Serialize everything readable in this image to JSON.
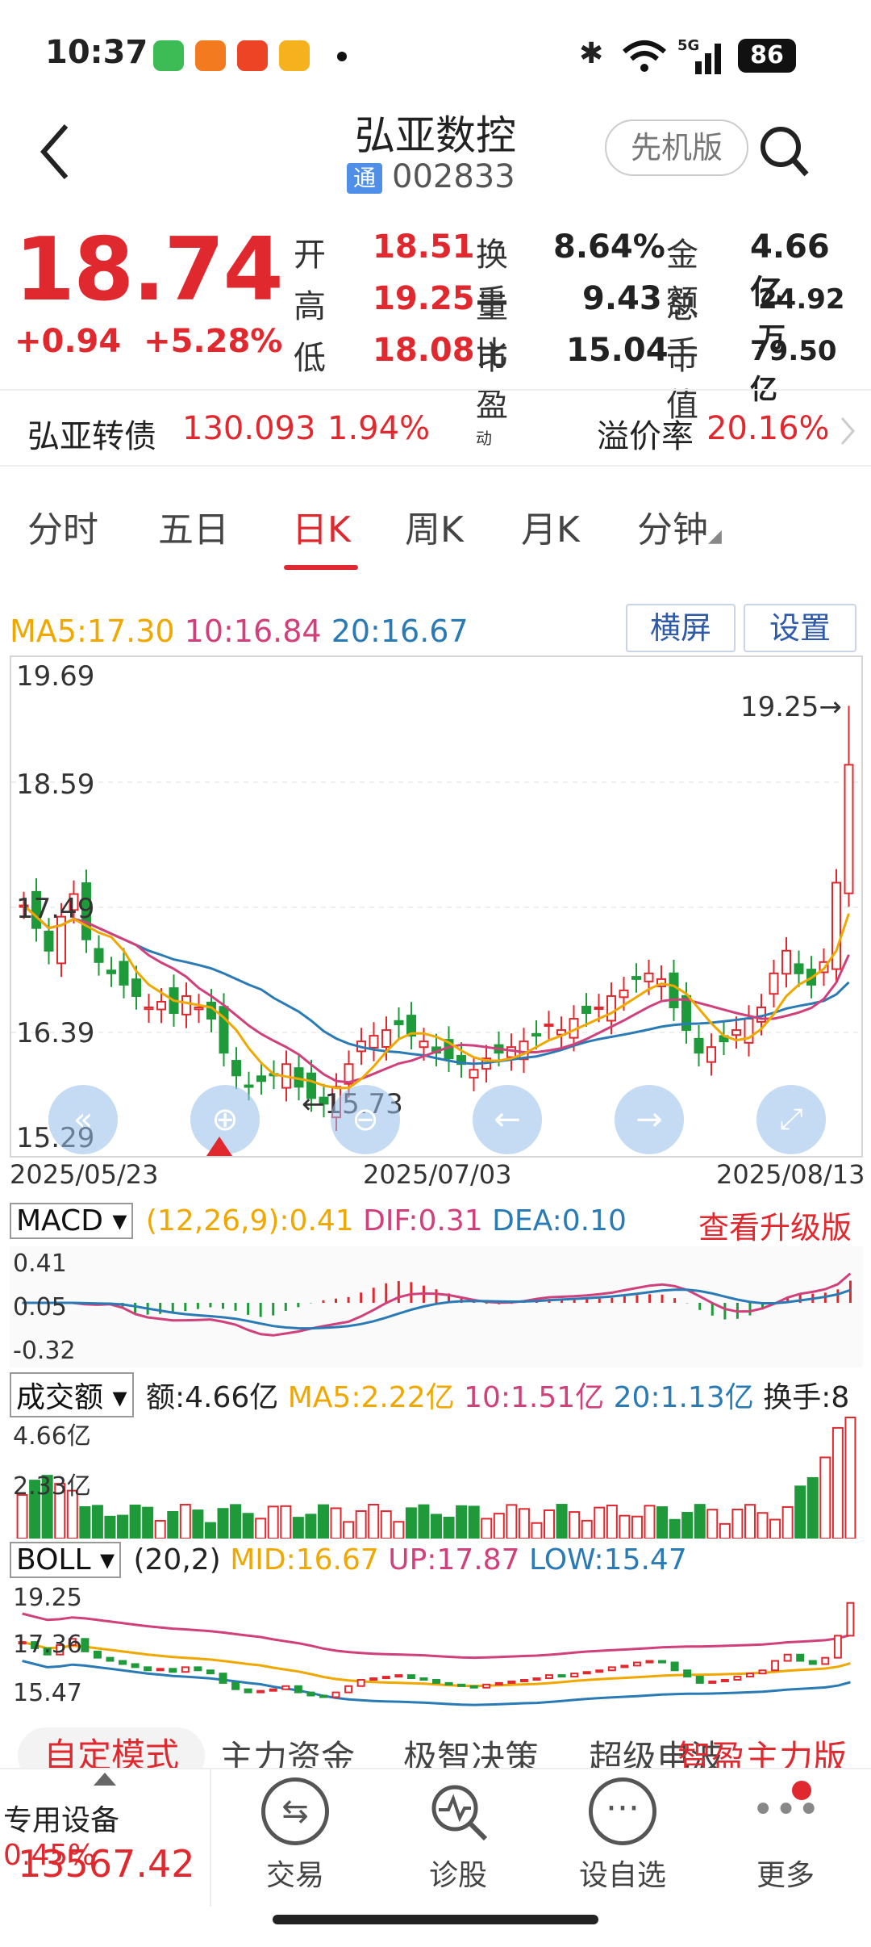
{
  "status": {
    "time": "10:37",
    "battery": "86",
    "network": "5G"
  },
  "header": {
    "name": "弘亚数控",
    "tong": "通",
    "code": "002833",
    "pill": "先机版"
  },
  "quote": {
    "price": "18.74",
    "change": "+0.94",
    "change_pct": "+5.28%",
    "rows": [
      [
        {
          "l": "开",
          "v": "18.51"
        },
        {
          "l": "换手",
          "v": "8.64%"
        },
        {
          "l": "金额",
          "v": "4.66亿"
        }
      ],
      [
        {
          "l": "高",
          "v": "19.25"
        },
        {
          "l": "量比",
          "v": "9.43"
        },
        {
          "l": "总手",
          "v": "24.92万"
        }
      ],
      [
        {
          "l": "低",
          "v": "18.08"
        },
        {
          "l": "市盈",
          "sup": "动",
          "v": "15.04"
        },
        {
          "l": "市值",
          "v": "79.50亿"
        }
      ]
    ]
  },
  "bond": {
    "name": "弘亚转债",
    "price": "130.093",
    "pct": "1.94%",
    "premium_label": "溢价率",
    "premium": "20.16%"
  },
  "tabs": [
    "分时",
    "五日",
    "日K",
    "周K",
    "月K",
    "分钟"
  ],
  "active_tab": "日K",
  "ma": {
    "ma5": "MA5:17.30",
    "ma10": "10:16.84",
    "ma20": "20:16.67"
  },
  "buttons": {
    "landscape": "横屏",
    "settings": "设置"
  },
  "kline": {
    "y_labels": [
      "19.69",
      "18.59",
      "17.49",
      "16.39",
      "15.29"
    ],
    "dates": [
      "2025/05/23",
      "2025/07/03",
      "2025/08/13"
    ],
    "high_mark": "19.25",
    "low_mark": "15.73"
  },
  "macd": {
    "name": "MACD",
    "params": "(12,26,9):0.41",
    "dif": "DIF:0.31",
    "dea": "DEA:0.10",
    "upgrade": "查看升级版",
    "y": [
      "0.41",
      "0.05",
      "-0.32"
    ]
  },
  "volume": {
    "name": "成交额",
    "amount": "额:4.66亿",
    "ma5": "MA5:2.22亿",
    "ma10": "10:1.51亿",
    "ma20": "20:1.13亿",
    "turnover": "换手:8",
    "y": [
      "4.66亿",
      "2.33亿"
    ]
  },
  "boll": {
    "name": "BOLL",
    "params": "(20,2)",
    "mid": "MID:16.67",
    "up": "UP:17.87",
    "low": "LOW:15.47",
    "y": [
      "19.25",
      "17.36",
      "15.47"
    ]
  },
  "bottom_tabs": [
    "自定模式",
    "主力资金",
    "极智决策",
    "超级电波",
    "智盈主力版"
  ],
  "footer": {
    "index_name": "专用设备",
    "index_pct": "0.45%",
    "index_value": "13567.42",
    "items": [
      "交易",
      "诊股",
      "设自选",
      "更多"
    ]
  },
  "colors": {
    "up": "#e0292f",
    "down": "#1f9a3a",
    "ma5": "#f0a800",
    "ma10": "#d0407a",
    "ma20": "#2a7bb5"
  }
}
